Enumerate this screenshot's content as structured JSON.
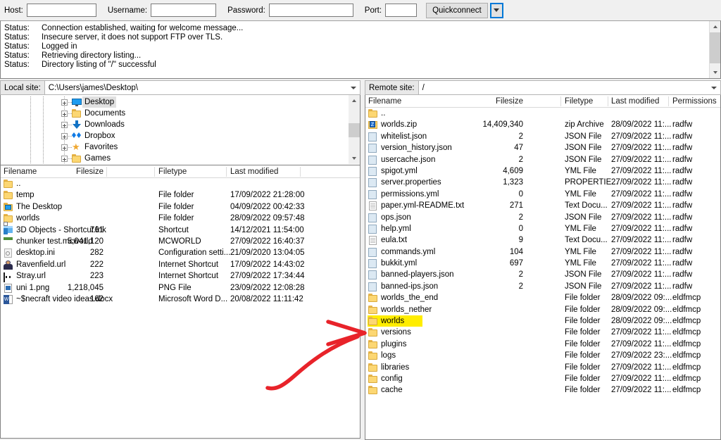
{
  "quickconnect": {
    "host_label": "Host:",
    "host_value": "",
    "username_label": "Username:",
    "username_value": "",
    "password_label": "Password:",
    "password_value": "",
    "port_label": "Port:",
    "port_value": "",
    "connect_label": "Quickconnect",
    "dropdown_icon": "chevron-down-icon"
  },
  "status_log": {
    "entries": [
      {
        "key": "Status:",
        "message": "Connection established, waiting for welcome message..."
      },
      {
        "key": "Status:",
        "message": "Insecure server, it does not support FTP over TLS."
      },
      {
        "key": "Status:",
        "message": "Logged in"
      },
      {
        "key": "Status:",
        "message": "Retrieving directory listing..."
      },
      {
        "key": "Status:",
        "message": "Directory listing of \"/\" successful"
      }
    ]
  },
  "local": {
    "site_label": "Local site:",
    "site_path": "C:\\Users\\james\\Desktop\\",
    "tree": [
      {
        "label": "Desktop",
        "icon": "monitor-icon",
        "selected": true
      },
      {
        "label": "Documents",
        "icon": "folder-icon",
        "selected": false
      },
      {
        "label": "Downloads",
        "icon": "download-icon",
        "selected": false
      },
      {
        "label": "Dropbox",
        "icon": "dropbox-icon",
        "selected": false
      },
      {
        "label": "Favorites",
        "icon": "star-icon",
        "selected": false
      },
      {
        "label": "Games",
        "icon": "folder-icon",
        "selected": false
      }
    ],
    "columns": [
      "Filename",
      "Filesize",
      "Filetype",
      "Last modified"
    ],
    "rows": [
      {
        "name": "..",
        "size": "",
        "type": "",
        "modified": "",
        "icon": "folder-icon"
      },
      {
        "name": "temp",
        "size": "",
        "type": "File folder",
        "modified": "17/09/2022 21:28:00",
        "icon": "folder-icon"
      },
      {
        "name": "The Desktop",
        "size": "",
        "type": "File folder",
        "modified": "04/09/2022 00:42:33",
        "icon": "desktop-folder-icon"
      },
      {
        "name": "worlds",
        "size": "",
        "type": "File folder",
        "modified": "28/09/2022 09:57:48",
        "icon": "folder-icon"
      },
      {
        "name": "3D Objects - Shortcut.lnk",
        "size": "761",
        "type": "Shortcut",
        "modified": "14/12/2021 11:54:00",
        "icon": "3d-objects-icon"
      },
      {
        "name": "chunker test.mcworld",
        "size": "5,041,120",
        "type": "MCWORLD",
        "modified": "27/09/2022 16:40:37",
        "icon": "minecraft-world-icon"
      },
      {
        "name": "desktop.ini",
        "size": "282",
        "type": "Configuration setti...",
        "modified": "21/09/2020 13:04:05",
        "icon": "config-file-icon"
      },
      {
        "name": "Ravenfield.url",
        "size": "222",
        "type": "Internet Shortcut",
        "modified": "17/09/2022 14:43:02",
        "icon": "ravenfield-icon"
      },
      {
        "name": "Stray.url",
        "size": "223",
        "type": "Internet Shortcut",
        "modified": "27/09/2022 17:34:44",
        "icon": "stray-icon"
      },
      {
        "name": "uni 1.png",
        "size": "1,218,045",
        "type": "PNG File",
        "modified": "23/09/2022 12:08:28",
        "icon": "png-file-icon"
      },
      {
        "name": "~$necraft video ideas.docx",
        "size": "162",
        "type": "Microsoft Word D...",
        "modified": "20/08/2022 11:11:42",
        "icon": "word-doc-icon"
      }
    ]
  },
  "remote": {
    "site_label": "Remote site:",
    "site_path": "/",
    "columns": [
      "Filename",
      "Filesize",
      "Filetype",
      "Last modified",
      "Permissions"
    ],
    "rows": [
      {
        "name": "..",
        "size": "",
        "type": "",
        "modified": "",
        "perms": "",
        "icon": "folder-icon",
        "highlight": false
      },
      {
        "name": "worlds.zip",
        "size": "14,409,340",
        "type": "zip Archive",
        "modified": "28/09/2022 11:...",
        "perms": "radfw",
        "icon": "zip-icon",
        "highlight": false
      },
      {
        "name": "whitelist.json",
        "size": "2",
        "type": "JSON File",
        "modified": "27/09/2022 11:...",
        "perms": "radfw",
        "icon": "blue-doc-icon",
        "highlight": false
      },
      {
        "name": "version_history.json",
        "size": "47",
        "type": "JSON File",
        "modified": "27/09/2022 11:...",
        "perms": "radfw",
        "icon": "blue-doc-icon",
        "highlight": false
      },
      {
        "name": "usercache.json",
        "size": "2",
        "type": "JSON File",
        "modified": "27/09/2022 11:...",
        "perms": "radfw",
        "icon": "blue-doc-icon",
        "highlight": false
      },
      {
        "name": "spigot.yml",
        "size": "4,609",
        "type": "YML File",
        "modified": "27/09/2022 11:...",
        "perms": "radfw",
        "icon": "blue-doc-icon",
        "highlight": false
      },
      {
        "name": "server.properties",
        "size": "1,323",
        "type": "PROPERTIE...",
        "modified": "27/09/2022 11:...",
        "perms": "radfw",
        "icon": "blue-doc-icon",
        "highlight": false
      },
      {
        "name": "permissions.yml",
        "size": "0",
        "type": "YML File",
        "modified": "27/09/2022 11:...",
        "perms": "radfw",
        "icon": "blue-doc-icon",
        "highlight": false
      },
      {
        "name": "paper.yml-README.txt",
        "size": "271",
        "type": "Text Docu...",
        "modified": "27/09/2022 11:...",
        "perms": "radfw",
        "icon": "text-doc-icon",
        "highlight": false
      },
      {
        "name": "ops.json",
        "size": "2",
        "type": "JSON File",
        "modified": "27/09/2022 11:...",
        "perms": "radfw",
        "icon": "blue-doc-icon",
        "highlight": false
      },
      {
        "name": "help.yml",
        "size": "0",
        "type": "YML File",
        "modified": "27/09/2022 11:...",
        "perms": "radfw",
        "icon": "blue-doc-icon",
        "highlight": false
      },
      {
        "name": "eula.txt",
        "size": "9",
        "type": "Text Docu...",
        "modified": "27/09/2022 11:...",
        "perms": "radfw",
        "icon": "text-doc-icon",
        "highlight": false
      },
      {
        "name": "commands.yml",
        "size": "104",
        "type": "YML File",
        "modified": "27/09/2022 11:...",
        "perms": "radfw",
        "icon": "blue-doc-icon",
        "highlight": false
      },
      {
        "name": "bukkit.yml",
        "size": "697",
        "type": "YML File",
        "modified": "27/09/2022 11:...",
        "perms": "radfw",
        "icon": "blue-doc-icon",
        "highlight": false
      },
      {
        "name": "banned-players.json",
        "size": "2",
        "type": "JSON File",
        "modified": "27/09/2022 11:...",
        "perms": "radfw",
        "icon": "blue-doc-icon",
        "highlight": false
      },
      {
        "name": "banned-ips.json",
        "size": "2",
        "type": "JSON File",
        "modified": "27/09/2022 11:...",
        "perms": "radfw",
        "icon": "blue-doc-icon",
        "highlight": false
      },
      {
        "name": "worlds_the_end",
        "size": "",
        "type": "File folder",
        "modified": "28/09/2022 09:...",
        "perms": "eldfmcp",
        "icon": "folder-icon",
        "highlight": false
      },
      {
        "name": "worlds_nether",
        "size": "",
        "type": "File folder",
        "modified": "28/09/2022 09:...",
        "perms": "eldfmcp",
        "icon": "folder-icon",
        "highlight": false
      },
      {
        "name": "worlds",
        "size": "",
        "type": "File folder",
        "modified": "28/09/2022 09:...",
        "perms": "eldfmcp",
        "icon": "folder-icon",
        "highlight": true
      },
      {
        "name": "versions",
        "size": "",
        "type": "File folder",
        "modified": "27/09/2022 11:...",
        "perms": "eldfmcp",
        "icon": "folder-icon",
        "highlight": false
      },
      {
        "name": "plugins",
        "size": "",
        "type": "File folder",
        "modified": "27/09/2022 11:...",
        "perms": "eldfmcp",
        "icon": "folder-icon",
        "highlight": false
      },
      {
        "name": "logs",
        "size": "",
        "type": "File folder",
        "modified": "27/09/2022 23:...",
        "perms": "eldfmcp",
        "icon": "folder-icon",
        "highlight": false
      },
      {
        "name": "libraries",
        "size": "",
        "type": "File folder",
        "modified": "27/09/2022 11:...",
        "perms": "eldfmcp",
        "icon": "folder-icon",
        "highlight": false
      },
      {
        "name": "config",
        "size": "",
        "type": "File folder",
        "modified": "27/09/2022 11:...",
        "perms": "eldfmcp",
        "icon": "folder-icon",
        "highlight": false
      },
      {
        "name": "cache",
        "size": "",
        "type": "File folder",
        "modified": "27/09/2022 11:...",
        "perms": "eldfmcp",
        "icon": "folder-icon",
        "highlight": false
      }
    ]
  },
  "annotation": {
    "type": "red-arrow",
    "color": "#e8232a",
    "points_to": "worlds"
  },
  "colors": {
    "highlight": "#ffed00",
    "selection": "#e0e0e0",
    "focus_border": "#0078d7",
    "annotation_red": "#e8232a"
  }
}
